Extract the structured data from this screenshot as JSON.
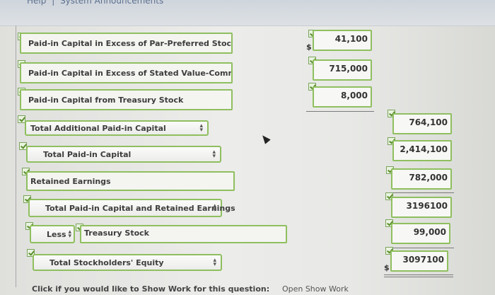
{
  "header": {
    "links": [
      "Help",
      "|",
      "System Announcements"
    ]
  },
  "rows": [
    {
      "label": "Paid-in Capital in Excess of Par-Preferred Stock",
      "value": "41,100",
      "dollar": "$"
    },
    {
      "label": "Paid-in Capital in Excess of Stated Value-Common",
      "value": "715,000"
    },
    {
      "label": "Paid-in Capital from Treasury Stock",
      "value": "8,000"
    },
    {
      "label": "Total Additional Paid-in Capital",
      "value": "764,100"
    },
    {
      "label": "Total Paid-in Capital",
      "value": "2,414,100"
    },
    {
      "label": "Retained Earnings",
      "value": "782,000"
    },
    {
      "label": "Total Paid-in Capital and Retained Earnings",
      "value": "3196100"
    },
    {
      "label": "Treasury Stock",
      "less": "Less",
      "value": "99,000"
    },
    {
      "label": "Total Stockholders' Equity",
      "value": "3097100",
      "dollar": "$"
    }
  ],
  "footer": {
    "prompt": "Click if you would like to Show Work for this question:",
    "link": "Open Show Work"
  },
  "colors": {
    "accent_border": "#8fbf5f",
    "check": "#5b8f2e"
  }
}
